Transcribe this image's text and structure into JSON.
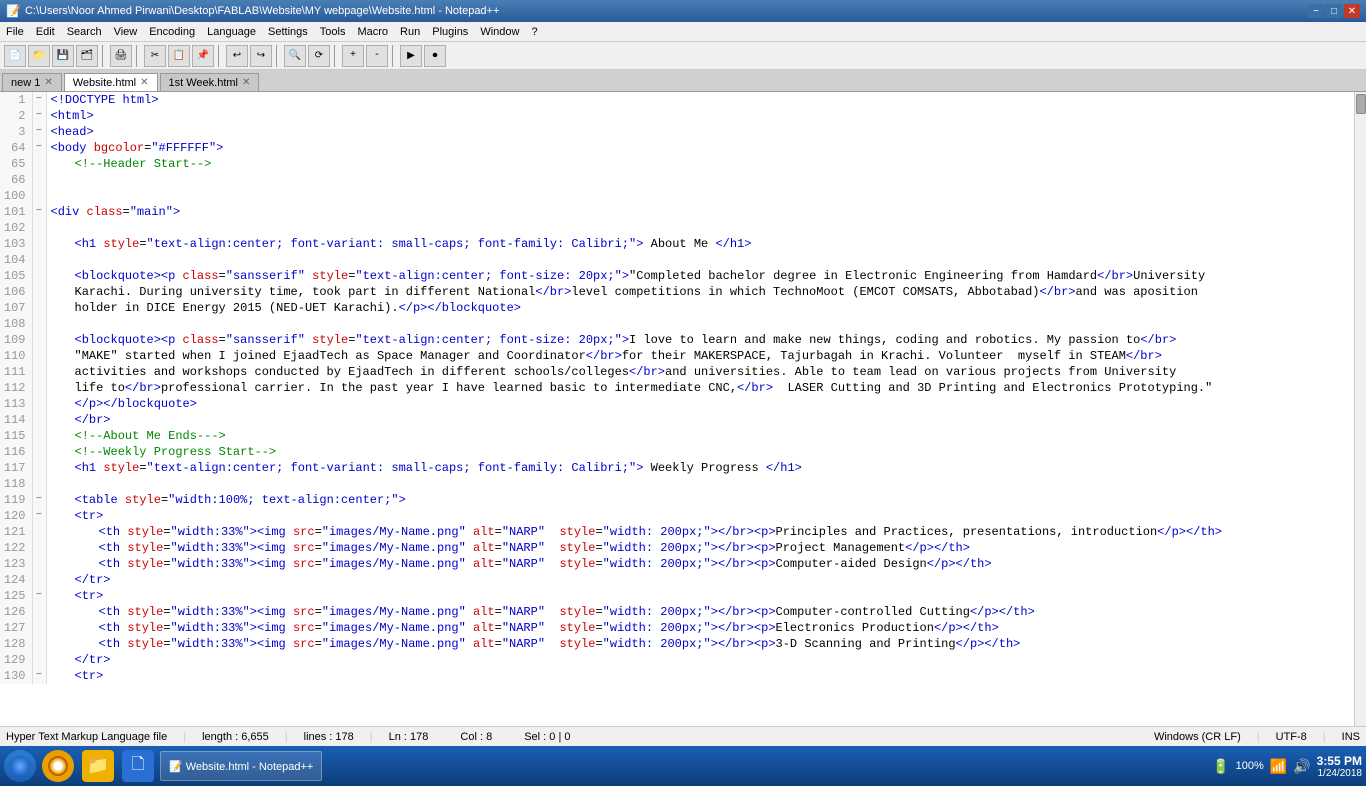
{
  "titleBar": {
    "title": "C:\\Users\\Noor Ahmed Pirwani\\Desktop\\FABLAB\\Website\\MY webpage\\Website.html - Notepad++",
    "controls": [
      "−",
      "□",
      "✕"
    ]
  },
  "menuBar": {
    "items": [
      "File",
      "Edit",
      "Search",
      "View",
      "Encoding",
      "Language",
      "Settings",
      "Tools",
      "Macro",
      "Run",
      "Plugins",
      "Window",
      "?"
    ]
  },
  "tabs": [
    {
      "label": "new 1",
      "active": false
    },
    {
      "label": "Website.html",
      "active": true
    },
    {
      "label": "1st Week.html",
      "active": false
    }
  ],
  "lines": [
    {
      "num": "1",
      "fold": "□",
      "content": "<!DOCTYPE html>",
      "classes": "tag"
    },
    {
      "num": "2",
      "fold": "□",
      "content": "<html>",
      "classes": "tag"
    },
    {
      "num": "3",
      "fold": "□",
      "content": "<head>",
      "classes": "tag"
    },
    {
      "num": "64",
      "fold": "□",
      "content": "<body bgcolor=\"#FFFFFF\">",
      "classes": "mixed"
    },
    {
      "num": "65",
      "fold": "",
      "content": "    <!--Header Start-->",
      "classes": "comment"
    },
    {
      "num": "66",
      "fold": "",
      "content": "",
      "classes": ""
    },
    {
      "num": "100",
      "fold": "",
      "content": "",
      "classes": ""
    },
    {
      "num": "101",
      "fold": "□",
      "content": "<div class=\"main\">",
      "classes": "mixed"
    },
    {
      "num": "102",
      "fold": "",
      "content": "",
      "classes": ""
    },
    {
      "num": "103",
      "fold": "",
      "content": "    <h1 style=\"text-align:center; font-variant: small-caps; font-family: Calibri;\"> About Me </h1>",
      "classes": "mixed"
    },
    {
      "num": "104",
      "fold": "",
      "content": "",
      "classes": ""
    },
    {
      "num": "105",
      "fold": "",
      "content": "    <blockquote><p class=\"sansserif\" style=\"text-align:center; font-size: 20px;\">\"Completed bachelor degree in Electronic Engineering from Hamdard</br>University",
      "classes": "long"
    },
    {
      "num": "106",
      "fold": "",
      "content": "    Karachi. During university time, took part in different National</br>level competitions in which TechnoMoot (EMCOT COMSATS, Abbotabad)</br>and was aposition",
      "classes": "long"
    },
    {
      "num": "107",
      "fold": "",
      "content": "    holder in DICE Energy 2015 (NED-UET Karachi).</p></blockquote>",
      "classes": "long"
    },
    {
      "num": "108",
      "fold": "",
      "content": "",
      "classes": ""
    },
    {
      "num": "109",
      "fold": "",
      "content": "    <blockquote><p class=\"sansserif\" style=\"text-align:center; font-size: 20px;\">I love to learn and make new things, coding and robotics. My passion to</br>",
      "classes": "long"
    },
    {
      "num": "110",
      "fold": "",
      "content": "    \"MAKE\" started when I joined EjaadTech as Space Manager and Coordinator</br>for their MAKERSPACE, Tajurbagah in Krachi. Volunteer  myself in STEAM</br>",
      "classes": "long"
    },
    {
      "num": "111",
      "fold": "",
      "content": "    activities and workshops conducted by EjaadTech in different schools/colleges</br>and universities. Able to team lead on various projects from University",
      "classes": "long"
    },
    {
      "num": "112",
      "fold": "",
      "content": "    life to</br>professional carrier. In the past year I have learned basic to intermediate CNC,</br>  LASER Cutting and 3D Printing and Electronics Prototyping.\"",
      "classes": "long"
    },
    {
      "num": "113",
      "fold": "",
      "content": "    </p></blockquote>",
      "classes": "tag"
    },
    {
      "num": "114",
      "fold": "",
      "content": "    </br>",
      "classes": "tag"
    },
    {
      "num": "115",
      "fold": "",
      "content": "    <!--About Me Ends--->",
      "classes": "comment"
    },
    {
      "num": "116",
      "fold": "",
      "content": "    <!--Weekly Progress Start-->",
      "classes": "comment"
    },
    {
      "num": "117",
      "fold": "",
      "content": "    <h1 style=\"text-align:center; font-variant: small-caps; font-family: Calibri;\"> Weekly Progress </h1>",
      "classes": "mixed"
    },
    {
      "num": "118",
      "fold": "",
      "content": "",
      "classes": ""
    },
    {
      "num": "119",
      "fold": "□",
      "content": "    <table style=\"width:100%; text-align:center;\">",
      "classes": "mixed"
    },
    {
      "num": "120",
      "fold": "□",
      "content": "    <tr>",
      "classes": "tag"
    },
    {
      "num": "121",
      "fold": "",
      "content": "        <th style=\"width:33%\"><img src=\"images/My-Name.png\" alt=\"NARP\"  style=\"width: 200px;\"></br><p>Principles and Practices, presentations, introduction</p></th>",
      "classes": "long"
    },
    {
      "num": "122",
      "fold": "",
      "content": "        <th style=\"width:33%\"><img src=\"images/My-Name.png\" alt=\"NARP\"  style=\"width: 200px;\"></br><p>Project Management</p></th>",
      "classes": "long"
    },
    {
      "num": "123",
      "fold": "",
      "content": "        <th style=\"width:33%\"><img src=\"images/My-Name.png\" alt=\"NARP\"  style=\"width: 200px;\"></br><p>Computer-aided Design</p></th>",
      "classes": "long"
    },
    {
      "num": "124",
      "fold": "",
      "content": "    </tr>",
      "classes": "tag"
    },
    {
      "num": "125",
      "fold": "□",
      "content": "    <tr>",
      "classes": "tag"
    },
    {
      "num": "126",
      "fold": "",
      "content": "        <th style=\"width:33%\"><img src=\"images/My-Name.png\" alt=\"NARP\"  style=\"width: 200px;\"></br><p>Computer-controlled Cutting</p></th>",
      "classes": "long"
    },
    {
      "num": "127",
      "fold": "",
      "content": "        <th style=\"width:33%\"><img src=\"images/My-Name.png\" alt=\"NARP\"  style=\"width: 200px;\"></br><p>Electronics Production</p></th>",
      "classes": "long"
    },
    {
      "num": "128",
      "fold": "",
      "content": "        <th style=\"width:33%\"><img src=\"images/My-Name.png\" alt=\"NARP\"  style=\"width: 200px;\"></br><p>3-D Scanning and Printing</p></th>",
      "classes": "long"
    },
    {
      "num": "129",
      "fold": "",
      "content": "    </tr>",
      "classes": "tag"
    },
    {
      "num": "130",
      "fold": "□",
      "content": "    <tr>",
      "classes": "tag"
    }
  ],
  "statusBar": {
    "fileType": "Hyper Text Markup Language file",
    "length": "length : 6,655",
    "lines": "lines : 178",
    "ln": "Ln : 178",
    "col": "Col : 8",
    "sel": "Sel : 0 | 0",
    "lineEnding": "Windows (CR LF)",
    "encoding": "UTF-8",
    "ins": "INS"
  },
  "taskbar": {
    "apps": [
      "Notepad++"
    ],
    "time": "3:55 PM",
    "date": "1/24/2018",
    "batteryPct": "100%"
  }
}
